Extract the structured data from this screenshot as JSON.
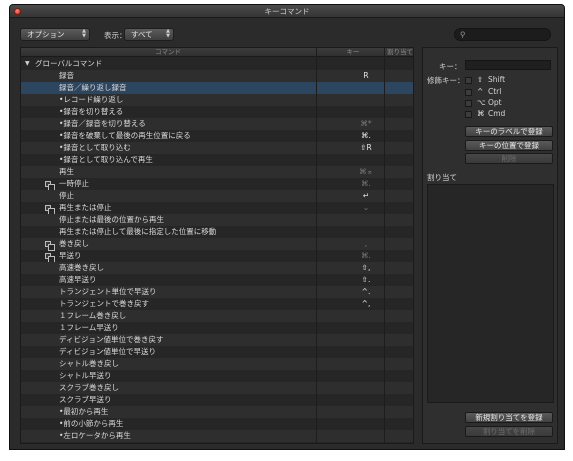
{
  "window": {
    "title": "キーコマンド"
  },
  "toolbar": {
    "options_popup": "オプション",
    "view_label": "表示：",
    "view_popup": "すべて",
    "search_placeholder": ""
  },
  "table": {
    "columns": [
      "コマンド",
      "キー",
      "割り当て"
    ],
    "rows": [
      {
        "name": "グローバルコマンド",
        "indent": 0,
        "icon": "disclosure",
        "key": "",
        "dim": false,
        "alt": false,
        "selected": false
      },
      {
        "name": "録音",
        "indent": 1,
        "icon": "",
        "key": "R",
        "dim": false,
        "alt": true,
        "selected": false
      },
      {
        "name": "録音／繰り返し録音",
        "indent": 1,
        "icon": "",
        "key": "",
        "dim": false,
        "alt": false,
        "selected": true
      },
      {
        "name": "•レコード繰り返し",
        "indent": 1,
        "icon": "",
        "key": "",
        "dim": false,
        "alt": true,
        "selected": false
      },
      {
        "name": "•録音を切り替える",
        "indent": 1,
        "icon": "",
        "key": "",
        "dim": false,
        "alt": false,
        "selected": false
      },
      {
        "name": "•録音／録音を切り替える",
        "indent": 1,
        "icon": "",
        "key": "⌘*",
        "dim": true,
        "alt": true,
        "selected": false
      },
      {
        "name": "•録音を破棄して最後の再生位置に戻る",
        "indent": 1,
        "icon": "",
        "key": "⌘.",
        "dim": false,
        "alt": false,
        "selected": false
      },
      {
        "name": "•録音として取り込む",
        "indent": 1,
        "icon": "",
        "key": "⇧R",
        "dim": false,
        "alt": true,
        "selected": false
      },
      {
        "name": "•録音として取り込んで再生",
        "indent": 1,
        "icon": "",
        "key": "",
        "dim": false,
        "alt": false,
        "selected": false
      },
      {
        "name": "再生",
        "indent": 1,
        "icon": "",
        "key": "⌘⌅",
        "dim": true,
        "alt": true,
        "selected": false
      },
      {
        "name": "一時停止",
        "indent": 1,
        "icon": "group",
        "key": "⌘.",
        "dim": true,
        "alt": false,
        "selected": false
      },
      {
        "name": "停止",
        "indent": 1,
        "icon": "",
        "key": "↵",
        "dim": false,
        "alt": true,
        "selected": false
      },
      {
        "name": "再生または停止",
        "indent": 1,
        "icon": "group",
        "key": "⌄",
        "dim": true,
        "alt": false,
        "selected": false
      },
      {
        "name": "停止または最後の位置から再生",
        "indent": 1,
        "icon": "",
        "key": "",
        "dim": false,
        "alt": true,
        "selected": false
      },
      {
        "name": "再生または停止して最後に指定した位置に移動",
        "indent": 1,
        "icon": "",
        "key": "",
        "dim": false,
        "alt": false,
        "selected": false
      },
      {
        "name": "巻き戻し",
        "indent": 1,
        "icon": "group",
        "key": ",",
        "dim": true,
        "alt": true,
        "selected": false
      },
      {
        "name": "早送り",
        "indent": 1,
        "icon": "group",
        "key": "⌘.",
        "dim": true,
        "alt": false,
        "selected": false
      },
      {
        "name": "高速巻き戻し",
        "indent": 1,
        "icon": "",
        "key": "⇧,",
        "dim": false,
        "alt": true,
        "selected": false
      },
      {
        "name": "高速早送り",
        "indent": 1,
        "icon": "",
        "key": "⇧.",
        "dim": false,
        "alt": false,
        "selected": false
      },
      {
        "name": "トランジェント単位で早送り",
        "indent": 1,
        "icon": "",
        "key": "^.",
        "dim": false,
        "alt": true,
        "selected": false
      },
      {
        "name": "トランジェントで巻き戻す",
        "indent": 1,
        "icon": "",
        "key": "^,",
        "dim": false,
        "alt": false,
        "selected": false
      },
      {
        "name": "１フレーム巻き戻し",
        "indent": 1,
        "icon": "",
        "key": "",
        "dim": false,
        "alt": true,
        "selected": false
      },
      {
        "name": "１フレーム早送り",
        "indent": 1,
        "icon": "",
        "key": "",
        "dim": false,
        "alt": false,
        "selected": false
      },
      {
        "name": "ディビジョン値単位で巻き戻す",
        "indent": 1,
        "icon": "",
        "key": "",
        "dim": false,
        "alt": true,
        "selected": false
      },
      {
        "name": "ディビジョン値単位で早送り",
        "indent": 1,
        "icon": "",
        "key": "",
        "dim": false,
        "alt": false,
        "selected": false
      },
      {
        "name": "シャトル巻き戻し",
        "indent": 1,
        "icon": "",
        "key": "",
        "dim": false,
        "alt": true,
        "selected": false
      },
      {
        "name": "シャトル早送り",
        "indent": 1,
        "icon": "",
        "key": "",
        "dim": false,
        "alt": false,
        "selected": false
      },
      {
        "name": "スクラブ巻き戻し",
        "indent": 1,
        "icon": "",
        "key": "",
        "dim": false,
        "alt": true,
        "selected": false
      },
      {
        "name": "スクラブ早送り",
        "indent": 1,
        "icon": "",
        "key": "",
        "dim": false,
        "alt": false,
        "selected": false
      },
      {
        "name": "•最初から再生",
        "indent": 1,
        "icon": "",
        "key": "",
        "dim": false,
        "alt": true,
        "selected": false
      },
      {
        "name": "•前の小節から再生",
        "indent": 1,
        "icon": "",
        "key": "",
        "dim": false,
        "alt": false,
        "selected": false
      },
      {
        "name": "•左ロケータから再生",
        "indent": 1,
        "icon": "",
        "key": "",
        "dim": false,
        "alt": true,
        "selected": false
      }
    ]
  },
  "panel": {
    "key_label": "キー：",
    "key_value": "",
    "modifier_label": "修飾キー：",
    "modifiers": [
      {
        "symbol": "⇧",
        "name": "Shift"
      },
      {
        "symbol": "^",
        "name": "Ctrl"
      },
      {
        "symbol": "⌥",
        "name": "Opt"
      },
      {
        "symbol": "⌘",
        "name": "Cmd"
      }
    ],
    "btn_learn_label": "キーのラベルで登録",
    "btn_learn_position": "キーの位置で登録",
    "btn_delete": "削除",
    "assignments_label": "割り当て",
    "btn_new_assignment": "新規割り当てを登録",
    "btn_delete_assignment": "割り当てを削除"
  },
  "colors": {
    "window_bg": "#2b2b2b",
    "selection": "#2d4660",
    "close_button": "#d0281a"
  }
}
